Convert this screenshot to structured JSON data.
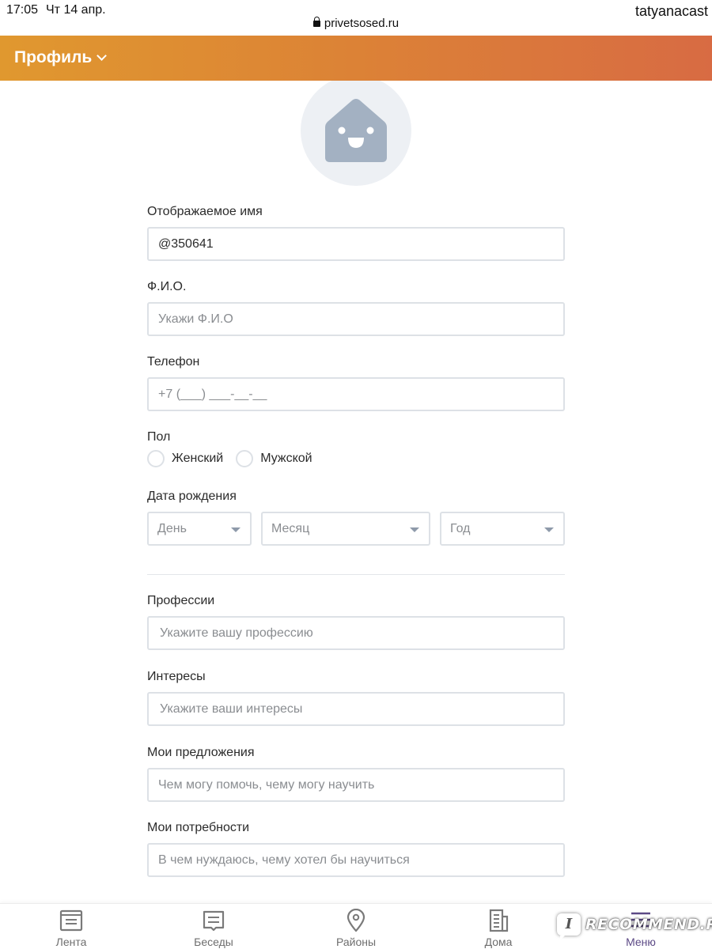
{
  "status_bar": {
    "time": "17:05",
    "date": "Чт 14 апр.",
    "url": "privetsosed.ru",
    "user": "tatyanacast"
  },
  "header": {
    "title": "Профиль",
    "gradient_start": "#E0982F",
    "gradient_end": "#D86B43"
  },
  "avatar": {
    "icon": "house-face-icon",
    "bg_color": "#EDF0F4",
    "icon_color": "#A3B1C2"
  },
  "form": {
    "display_name": {
      "label": "Отображаемое имя",
      "value": "@350641",
      "placeholder": ""
    },
    "full_name": {
      "label": "Ф.И.О.",
      "value": "",
      "placeholder": "Укажи Ф.И.О"
    },
    "phone": {
      "label": "Телефон",
      "value": "",
      "placeholder": "+7 (___) ___-__-__"
    },
    "gender": {
      "label": "Пол",
      "options": [
        {
          "label": "Женский",
          "checked": false
        },
        {
          "label": "Мужской",
          "checked": false
        }
      ]
    },
    "birth_date": {
      "label": "Дата рождения",
      "day": "День",
      "month": "Месяц",
      "year": "Год"
    },
    "professions": {
      "label": "Профессии",
      "value": "",
      "placeholder": "Укажите вашу профессию"
    },
    "interests": {
      "label": "Интересы",
      "value": "",
      "placeholder": "Укажите ваши интересы"
    },
    "offers": {
      "label": "Мои предложения",
      "value": "",
      "placeholder": "Чем могу помочь, чему могу научить"
    },
    "needs": {
      "label": "Мои потребности",
      "value": "",
      "placeholder": "В чем нуждаюсь, чему хотел бы научиться"
    }
  },
  "bottom_nav": {
    "active_color": "#5C4A86",
    "items": [
      {
        "label": "Лента",
        "icon": "feed-icon",
        "active": false
      },
      {
        "label": "Беседы",
        "icon": "chat-icon",
        "active": false
      },
      {
        "label": "Районы",
        "icon": "location-pin-icon",
        "active": false
      },
      {
        "label": "Дома",
        "icon": "building-icon",
        "active": false
      },
      {
        "label": "Меню",
        "icon": "menu-icon",
        "active": true
      }
    ]
  },
  "watermark": {
    "badge": "I",
    "text": "RECOMMEND.RU"
  }
}
